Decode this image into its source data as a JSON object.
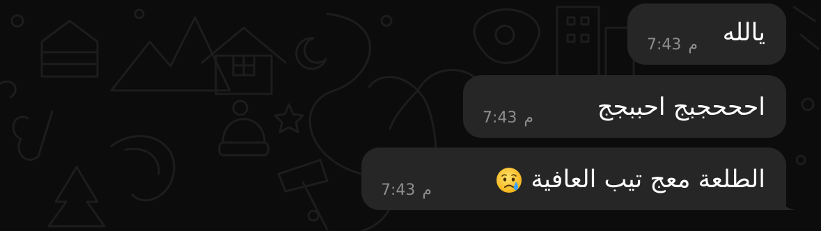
{
  "conversation": {
    "messages": [
      {
        "text": "يالله",
        "time": "7:43",
        "ampm": "م"
      },
      {
        "text": "احححجبج احببجج",
        "time": "7:43",
        "ampm": "م"
      },
      {
        "text": "الطلعة معج تيب العافية",
        "emoji": "crying-face-emoji",
        "time": "7:43",
        "ampm": "م"
      }
    ]
  },
  "colors": {
    "background": "#0c0c0c",
    "bubble": "#262626",
    "text": "#ffffff",
    "timestamp": "#8e8e8e",
    "wallpaper_lines": "#1c1c1c"
  }
}
